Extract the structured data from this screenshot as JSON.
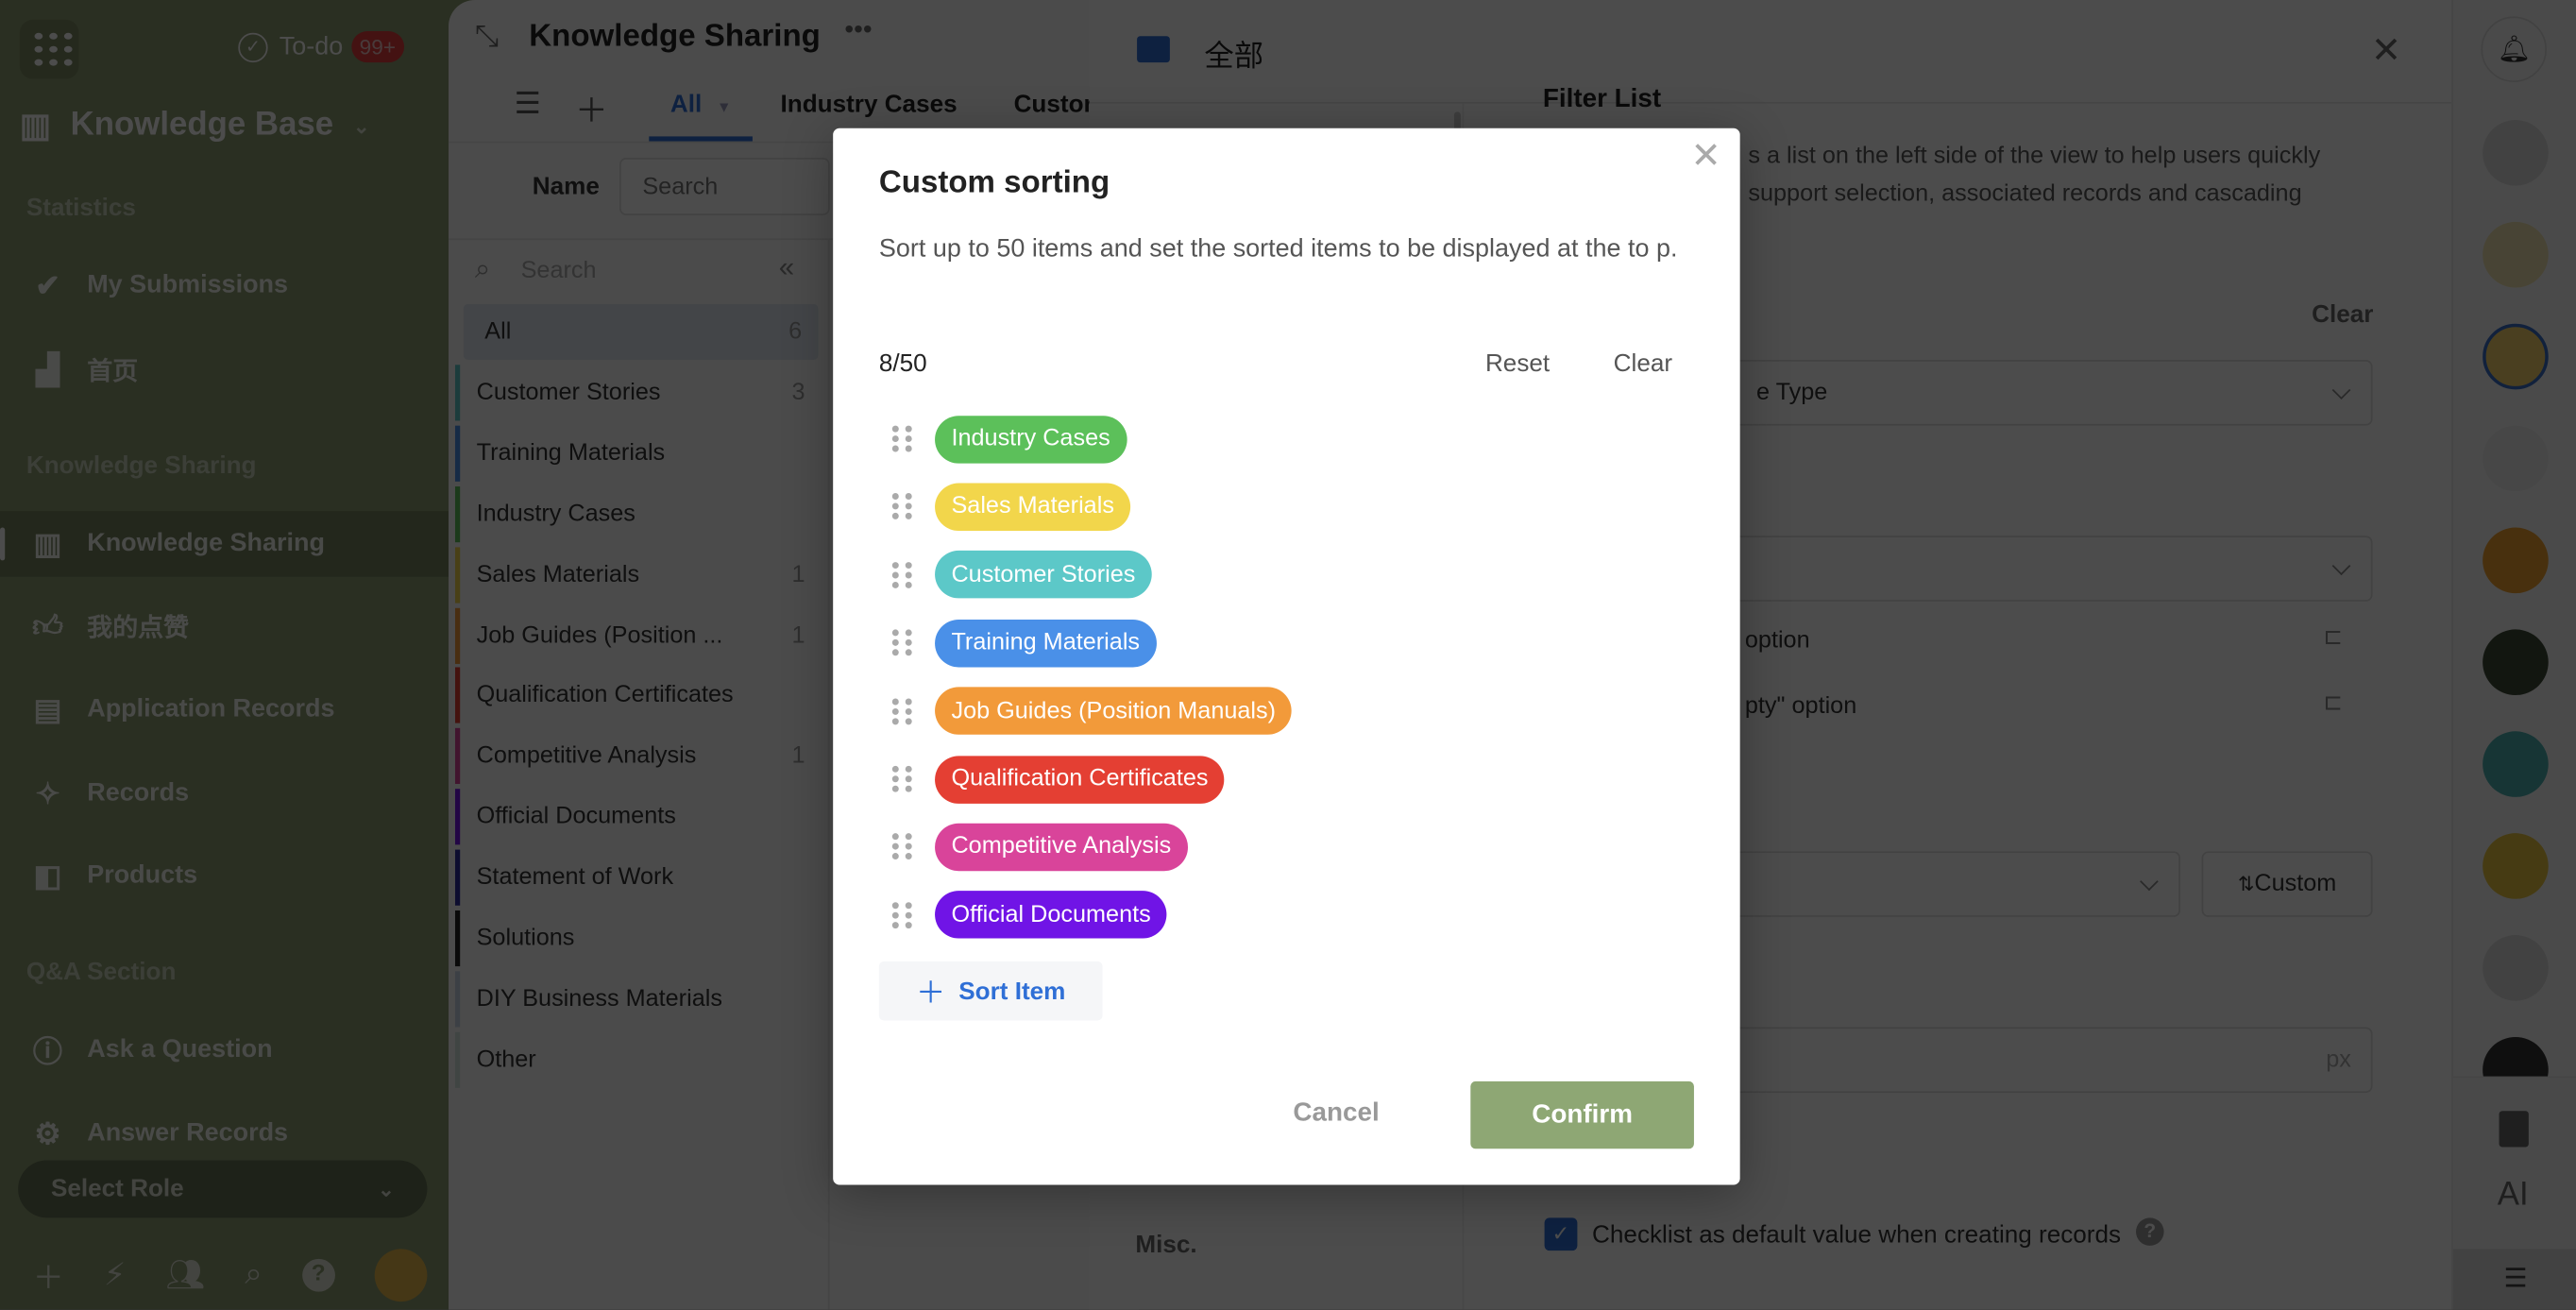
{
  "sidebar": {
    "todo_label": "To-do",
    "todo_badge": "99+",
    "app_title": "Knowledge Base",
    "sections": {
      "statistics": "Statistics",
      "knowledge": "Knowledge Sharing",
      "qa": "Q&A Section"
    },
    "items": [
      {
        "label": "My Submissions",
        "icon": "check-circle-icon"
      },
      {
        "label": "首页",
        "icon": "dashboard-icon"
      },
      {
        "label": "Knowledge Sharing",
        "icon": "library-icon",
        "active": true
      },
      {
        "label": "我的点赞",
        "icon": "thumbs-up-icon"
      },
      {
        "label": "Application Records",
        "icon": "id-card-icon"
      },
      {
        "label": "Records",
        "icon": "magic-wand-icon"
      },
      {
        "label": "Products",
        "icon": "book-icon"
      },
      {
        "label": "Ask a Question",
        "icon": "info-bubble-icon"
      },
      {
        "label": "Answer Records",
        "icon": "head-gear-icon"
      }
    ],
    "select_role": "Select Role"
  },
  "main": {
    "title": "Knowledge Sharing",
    "tabs": [
      "All",
      "Industry Cases",
      "Custor"
    ],
    "name_label": "Name",
    "search_placeholder": "Search",
    "list_search_placeholder": "Search",
    "list": [
      {
        "label": "All",
        "count": "6",
        "color": "#dfe6f0"
      },
      {
        "label": "Customer Stories",
        "count": "3",
        "color": "#5cc8c8"
      },
      {
        "label": "Training Materials",
        "count": "",
        "color": "#4a90e8"
      },
      {
        "label": "Industry Cases",
        "count": "",
        "color": "#5cc05a"
      },
      {
        "label": "Sales Materials",
        "count": "1",
        "color": "#f2d64b"
      },
      {
        "label": "Job Guides (Position ...",
        "count": "1",
        "color": "#f29a3a"
      },
      {
        "label": "Qualification Certificates",
        "count": "",
        "color": "#e43f33"
      },
      {
        "label": "Competitive Analysis",
        "count": "1",
        "color": "#d9449a"
      },
      {
        "label": "Official Documents",
        "count": "",
        "color": "#7014e6"
      },
      {
        "label": "Statement of Work",
        "count": "",
        "color": "#2b2b9e"
      },
      {
        "label": "Solutions",
        "count": "",
        "color": "#222222"
      },
      {
        "label": "DIY Business Materials",
        "count": "",
        "color": "#c8d4e6"
      },
      {
        "label": "Other",
        "count": "",
        "color": "#d4e6e0"
      }
    ]
  },
  "drawer": {
    "title": "全部",
    "section_title": "Filter List",
    "desc_line1": "s a list on the left side of the view to help users quickly",
    "desc_line2": "support selection, associated records and cascading",
    "clear": "Clear",
    "select1": "e Type",
    "option1": "option",
    "option2": "pty\" option",
    "custom_btn": "Custom",
    "px_unit": "px",
    "misc": "Misc.",
    "checklist_label": "Checklist as default value when creating records"
  },
  "rail": {
    "ai_label": "AI"
  },
  "modal": {
    "title": "Custom sorting",
    "description": "Sort up to 50 items and set the sorted items to be displayed at the to p.",
    "count": "8/50",
    "reset": "Reset",
    "clear": "Clear",
    "items": [
      {
        "label": "Industry Cases",
        "color": "#5cc05a"
      },
      {
        "label": "Sales Materials",
        "color": "#f2d64b"
      },
      {
        "label": "Customer Stories",
        "color": "#5cc8c8"
      },
      {
        "label": "Training Materials",
        "color": "#4a90e8"
      },
      {
        "label": "Job Guides (Position Manuals)",
        "color": "#f29a3a"
      },
      {
        "label": "Qualification Certificates",
        "color": "#e43f33"
      },
      {
        "label": "Competitive Analysis",
        "color": "#d9449a"
      },
      {
        "label": "Official Documents",
        "color": "#7014e6"
      }
    ],
    "add_item": "Sort Item",
    "cancel": "Cancel",
    "confirm": "Confirm",
    "confirm_color": "#8ea774"
  }
}
